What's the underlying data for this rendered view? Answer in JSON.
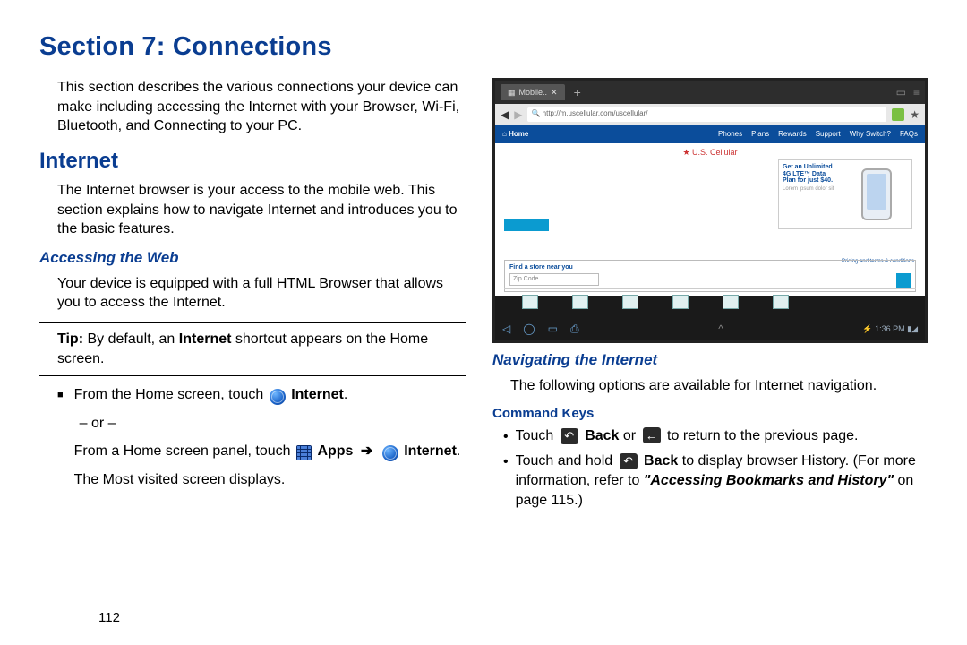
{
  "section_title": "Section 7: Connections",
  "page_number": "112",
  "left": {
    "intro": "This section describes the various connections your device can make including accessing the Internet with your Browser, Wi-Fi, Bluetooth, and Connecting to your PC.",
    "h_internet": "Internet",
    "internet_body": "The Internet browser is your access to the mobile web. This section explains how to navigate Internet and introduces you to the basic features.",
    "h_access": "Accessing the Web",
    "access_body": "Your device is equipped with a full HTML Browser that allows you to access the Internet.",
    "tip_label": "Tip:",
    "tip_body1": " By default, an ",
    "tip_bold": "Internet",
    "tip_body2": " shortcut appears on the Home screen.",
    "step1a": "From the Home screen, touch ",
    "step1_label": "Internet",
    "or": "– or –",
    "step2a": "From a Home screen panel, touch ",
    "apps_label": "Apps",
    "arrow": "➔",
    "step2_label": "Internet",
    "period": ".",
    "step3": "The Most visited screen displays."
  },
  "right": {
    "h_nav": "Navigating the Internet",
    "nav_body": "The following options are available for Internet navigation.",
    "h_cmd": "Command Keys",
    "b1a": "Touch ",
    "b1_back": "Back",
    "b1b": " or ",
    "b1c": " to return to the previous page.",
    "b2a": "Touch and hold ",
    "b2_back": "Back",
    "b2b": " to display browser History. (For more information, refer to ",
    "b2_ref": "\"Accessing Bookmarks and History\"",
    "b2c": " on page 115.)"
  },
  "shot": {
    "tab": "Mobile..",
    "url": "http://m.uscellular.com/uscellular/",
    "home": "Home",
    "nav": [
      "Phones",
      "Plans",
      "Rewards",
      "Support",
      "Why Switch?",
      "FAQs"
    ],
    "carrier": "U.S. Cellular",
    "promo": "Get an Unlimited 4G LTE™ Data Plan for just $40.",
    "terms": "Pricing and terms & conditions",
    "find": "Find a store near you",
    "zip": "Zip Code",
    "time": "1:36 PM"
  }
}
